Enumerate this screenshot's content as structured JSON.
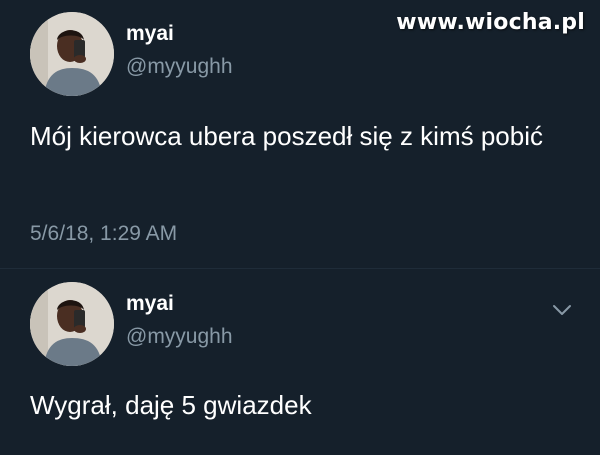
{
  "watermark": "www.wiocha.pl",
  "tweets": [
    {
      "name": "myai",
      "handle": "@myyughh",
      "text": "Mój kierowca ubera poszedł się z kimś pobić",
      "timestamp": "5/6/18, 1:29 AM",
      "avatar_icon": "avatar-photo"
    },
    {
      "name": "myai",
      "handle": "@myyughh",
      "text": "Wygrał, daję 5 gwiazdek",
      "avatar_icon": "avatar-photo",
      "menu_icon": "chevron-down-icon"
    }
  ],
  "colors": {
    "background": "#15202b",
    "secondary_text": "#8899a6",
    "primary_text": "#ffffff"
  }
}
